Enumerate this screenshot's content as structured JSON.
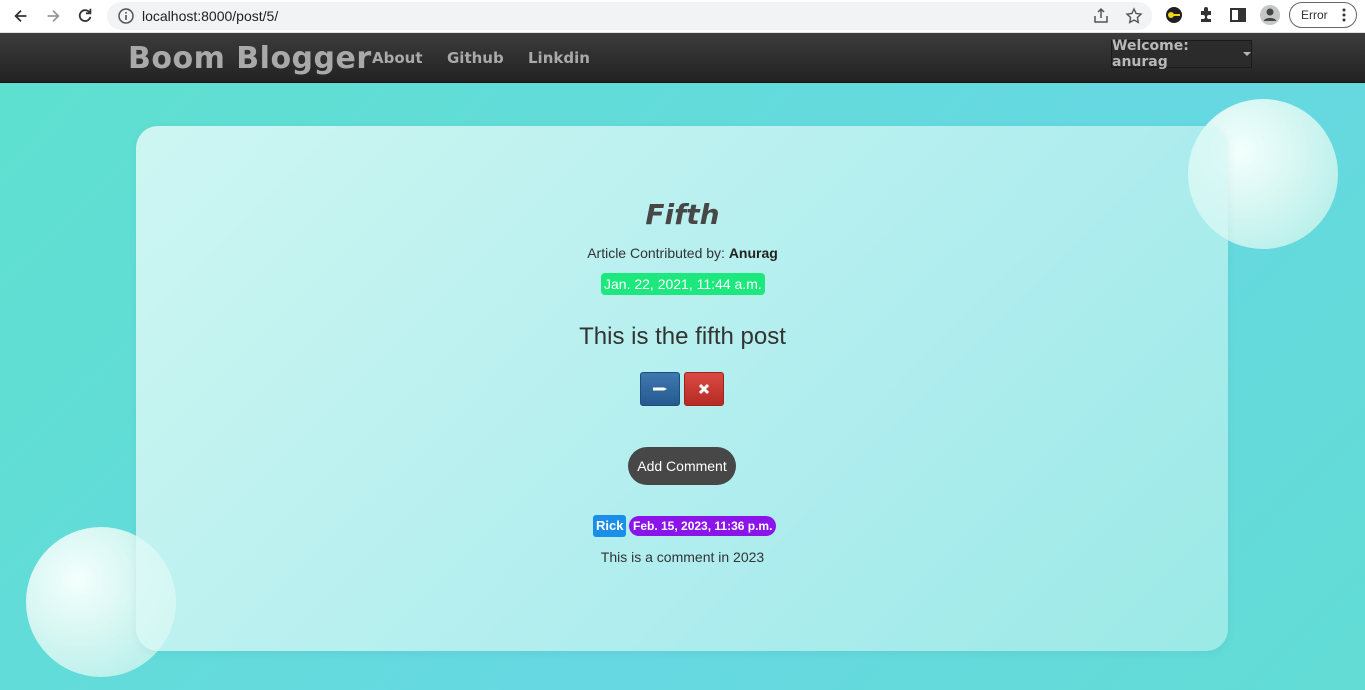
{
  "browser": {
    "url": "localhost:8000/post/5/",
    "profile_status": "Error"
  },
  "navbar": {
    "brand": "Boom Blogger",
    "links": [
      "About",
      "Github",
      "Linkdin"
    ],
    "welcome": "Welcome: anurag"
  },
  "post": {
    "title": "Fifth",
    "byline_prefix": "Article Contributed by:",
    "author": "Anurag",
    "date": "Jan. 22, 2021, 11:44 a.m.",
    "body": "This is the fifth post",
    "add_comment_label": "Add Comment"
  },
  "comment": {
    "user": "Rick",
    "timestamp": "Feb. 15, 2023, 11:36 p.m.",
    "text": "This is a comment in 2023"
  },
  "colors": {
    "background": "#62d9d4",
    "navbar": "#2b2b2b",
    "date_badge": "#1de87e",
    "edit_button": "#2f6aa3",
    "delete_button": "#c9362f",
    "add_comment_button": "#474747",
    "user_badge": "#1a8ee8",
    "time_badge": "#8b14ea"
  }
}
